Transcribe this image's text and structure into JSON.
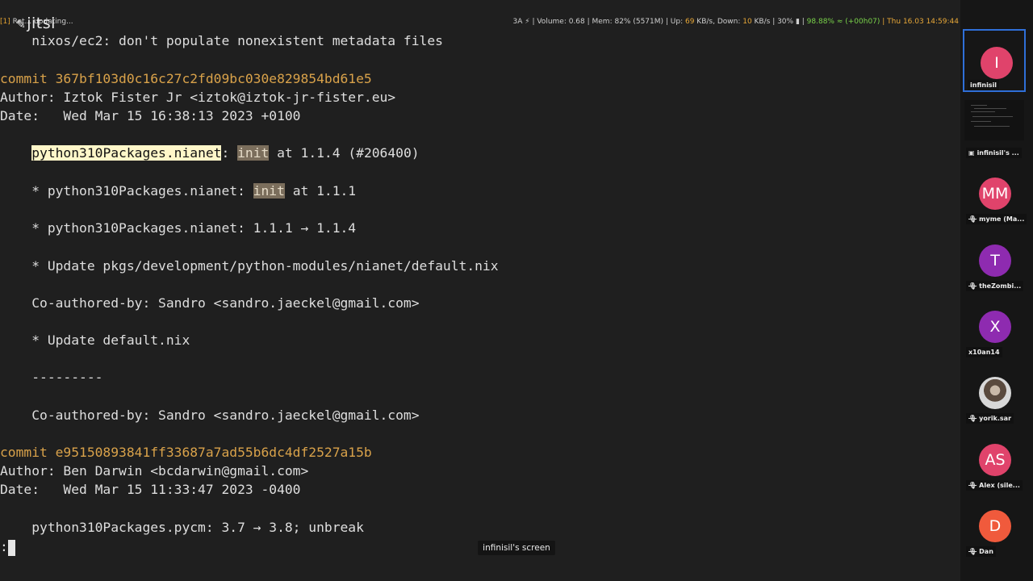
{
  "app": {
    "logo": "jitsi",
    "logo_mark": "✎"
  },
  "status_bar": {
    "workspace": "[1]",
    "updating": "Ret... updating...",
    "segments": [
      {
        "text": "3A ⚡ | Volume: 0.68 | Mem: 82% (5571M) | Up: ",
        "style": "normal"
      },
      {
        "text": "69",
        "style": "orange"
      },
      {
        "text": " KB/s, Down: ",
        "style": "normal"
      },
      {
        "text": "10",
        "style": "orange"
      },
      {
        "text": " KB/s | 30% ▮ | ",
        "style": "normal"
      },
      {
        "text": "98.88% ≈ (+00h07)",
        "style": "green"
      },
      {
        "text": " | Thu 16.03 14:59:44",
        "style": "orange"
      }
    ]
  },
  "terminal": {
    "prev_message": "    nixos/ec2: don't populate nonexistent metadata files",
    "commit1": {
      "hash_line": "commit 367bf103d0c16c27c2fd09bc030e829854bd61e5",
      "author": "Author: Iztok Fister Jr <iztok@iztok-jr-fister.eu>",
      "date": "Date:   Wed Mar 15 16:38:13 2023 +0100",
      "subject_indent": "    ",
      "subject_match": "python310Packages.nianet",
      "subject_colon": ": ",
      "subject_init": "init",
      "subject_rest": " at 1.1.4 (#206400)",
      "body_item1_pre": "    * python310Packages.nianet: ",
      "body_item1_init": "init",
      "body_item1_post": " at 1.1.1",
      "body_item2": "    * python310Packages.nianet: 1.1.1 → 1.1.4",
      "body_item3": "    * Update pkgs/development/python-modules/nianet/default.nix",
      "coauthor1": "    Co-authored-by: Sandro <sandro.jaeckel@gmail.com>",
      "body_item4": "    * Update default.nix",
      "separator": "    ---------",
      "coauthor2": "    Co-authored-by: Sandro <sandro.jaeckel@gmail.com>"
    },
    "commit2": {
      "hash_line": "commit e95150893841ff33687a7ad55b6dc4df2527a15b",
      "author": "Author: Ben Darwin <bcdarwin@gmail.com>",
      "date": "Date:   Wed Mar 15 11:33:47 2023 -0400",
      "subject": "    python310Packages.pycm: 3.7 → 3.8; unbreak"
    },
    "prompt": ":"
  },
  "screen_label": "infinisil's screen",
  "participants": [
    {
      "initials": "I",
      "name": "infinisil",
      "color": "#e0436b",
      "active": true,
      "muted": false
    },
    {
      "initials": "",
      "name": "infinisil's ...",
      "color": "",
      "screen": true,
      "muted": false
    },
    {
      "initials": "MM",
      "name": "myme (Ma...",
      "color": "#e0436b",
      "muted": true
    },
    {
      "initials": "T",
      "name": "theZombi...",
      "color": "#8e2bb0",
      "muted": true
    },
    {
      "initials": "X",
      "name": "x10an14",
      "color": "#8e2bb0",
      "muted": false
    },
    {
      "initials": "",
      "name": "yorik.sar",
      "color": "",
      "photo": true,
      "muted": true
    },
    {
      "initials": "AS",
      "name": "Alex (sile...",
      "color": "#e0436b",
      "muted": true
    },
    {
      "initials": "D",
      "name": "Dan",
      "color": "#f05a3c",
      "muted": true
    }
  ],
  "icons": {
    "mute": "mic-off-icon",
    "screen": "screen-share-icon"
  }
}
